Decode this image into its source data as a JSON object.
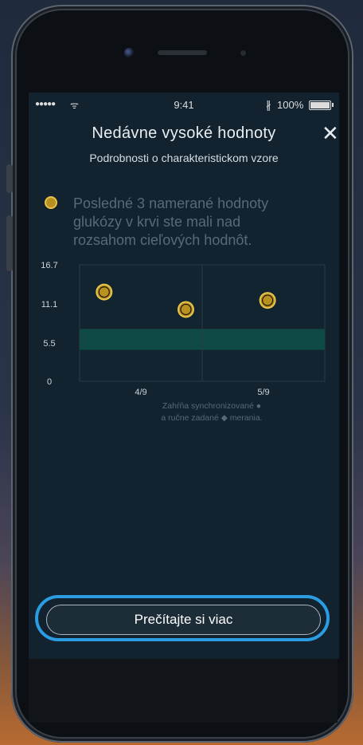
{
  "status_bar": {
    "signal": "●●●●●",
    "wifi": "ᯤ",
    "time": "9:41",
    "bluetooth": "∦",
    "battery": "100%"
  },
  "header": {
    "title": "Nedávne vysoké hodnoty",
    "close_icon": "✕",
    "subtitle": "Podrobnosti o charakteristickom vzore"
  },
  "description": "Posledné 3 namerané hodnoty glukózy v krvi ste mali nad rozsahom cieľových hodnôt.",
  "colors": {
    "accent": "#2a9de2",
    "marker_fill": "#b89120",
    "marker_stroke": "#e6c34a",
    "target_band": "#0f4a47"
  },
  "chart_data": {
    "type": "scatter",
    "y_ticks": [
      "16.7",
      "11.1",
      "5.5",
      "0"
    ],
    "ylim": [
      0,
      16.7
    ],
    "x_ticks": [
      "4/9",
      "5/9"
    ],
    "target_range": [
      4.5,
      7.5
    ],
    "series": [
      {
        "points": [
          {
            "x": 0.3,
            "y": 12.8
          },
          {
            "x": 1.3,
            "y": 10.3
          },
          {
            "x": 2.3,
            "y": 11.6
          }
        ]
      }
    ],
    "grid": true
  },
  "legend": {
    "line1": "Zahŕňa synchronizované ●",
    "line2": "a ručne zadané ◆ merania."
  },
  "cta": {
    "label": "Prečítajte si viac"
  }
}
